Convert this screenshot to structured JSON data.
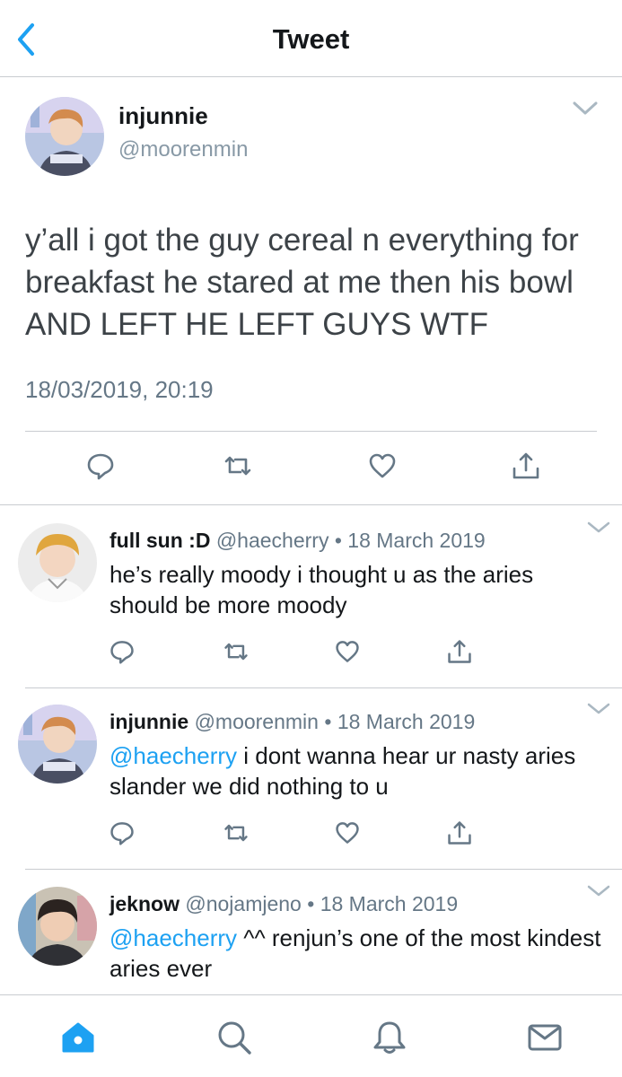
{
  "header": {
    "title": "Tweet",
    "back_icon": "chevron-left-icon"
  },
  "tweet": {
    "name": "injunnie",
    "handle": "@moorenmin",
    "text": "y’all i got the guy cereal n everything for breakfast he stared at me then his bowl AND LEFT HE LEFT GUYS WTF",
    "date": "18/03/2019, 20:19",
    "actions": [
      "reply-icon",
      "retweet-icon",
      "like-icon",
      "share-icon"
    ]
  },
  "replies": [
    {
      "name": "full sun :D",
      "handle": "@haecherry",
      "dot": "•",
      "date": "18 March 2019",
      "mention": "",
      "text": "he’s really moody i thought u as the aries should be more moody"
    },
    {
      "name": "injunnie",
      "handle": "@moorenmin",
      "dot": "•",
      "date": "18 March 2019",
      "mention": "@haecherry",
      "text": " i dont wanna hear ur nasty aries slander we did nothing to u"
    },
    {
      "name": "jeknow",
      "handle": "@nojamjeno",
      "dot": "•",
      "date": "18 March 2019",
      "mention": "@haecherry",
      "text": " ^^ renjun’s one of the most kindest aries ever"
    }
  ],
  "tabbar": {
    "tabs": [
      "home-icon",
      "search-icon",
      "notifications-icon",
      "messages-icon"
    ],
    "active": "home-icon",
    "accent": "#1da1f2"
  },
  "colors": {
    "accent": "#1da1f2",
    "muted": "#657786",
    "icon": "#657786",
    "divider": "#c9ccd0"
  }
}
